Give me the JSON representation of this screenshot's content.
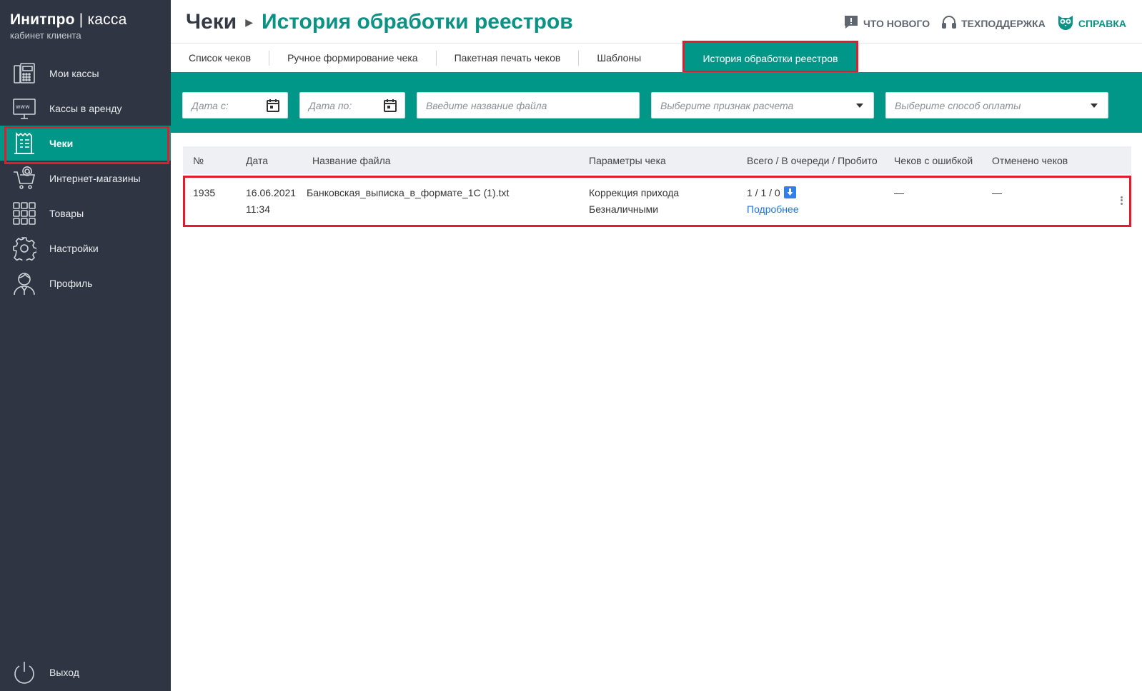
{
  "app": {
    "logo_main": "Инитпро",
    "logo_divider": " | ",
    "logo_light": "касса",
    "logo_sub": "кабинет клиента"
  },
  "sidebar": {
    "items": [
      {
        "label": "Мои кассы",
        "icon": "cash-register-icon"
      },
      {
        "label": "Кассы в аренду",
        "icon": "www-monitor-icon"
      },
      {
        "label": "Чеки",
        "icon": "receipt-icon",
        "active": true
      },
      {
        "label": "Интернет-магазины",
        "icon": "cart-at-icon"
      },
      {
        "label": "Товары",
        "icon": "grid-icon"
      },
      {
        "label": "Настройки",
        "icon": "gear-icon"
      },
      {
        "label": "Профиль",
        "icon": "user-icon"
      }
    ],
    "logout_label": "Выход"
  },
  "header": {
    "crumb_parent": "Чеки",
    "crumb_current": "История обработки реестров",
    "links": {
      "whats_new": "ЧТО НОВОГО",
      "support": "ТЕХПОДДЕРЖКА",
      "help": "СПРАВКА"
    }
  },
  "tabs": [
    "Список чеков",
    "Ручное формирование чека",
    "Пакетная печать чеков",
    "Шаблоны",
    "История обработки реестров"
  ],
  "filters": {
    "date_from_placeholder": "Дата с:",
    "date_to_placeholder": "Дата по:",
    "filename_placeholder": "Введите название файла",
    "calc_sign_placeholder": "Выберите признак расчета",
    "payment_method_placeholder": "Выберите способ оплаты"
  },
  "table": {
    "headers": [
      "№",
      "Дата",
      "Название файла",
      "Параметры чека",
      "Всего / В очереди / Пробито",
      "Чеков с ошибкой",
      "Отменено чеков"
    ],
    "rows": [
      {
        "num": "1935",
        "date": "16.06.2021",
        "time": "11:34",
        "filename": "Банковская_выписка_в_формате_1С (1).txt",
        "param1": "Коррекция прихода",
        "param2": "Безналичными",
        "counts": "1 / 1 / 0",
        "details_link": "Подробнее",
        "errors": "—",
        "cancelled": "—"
      }
    ]
  },
  "colors": {
    "sidebar_bg": "#2f3542",
    "accent": "#009688",
    "highlight": "#e11d2d",
    "link": "#1a73e8"
  }
}
